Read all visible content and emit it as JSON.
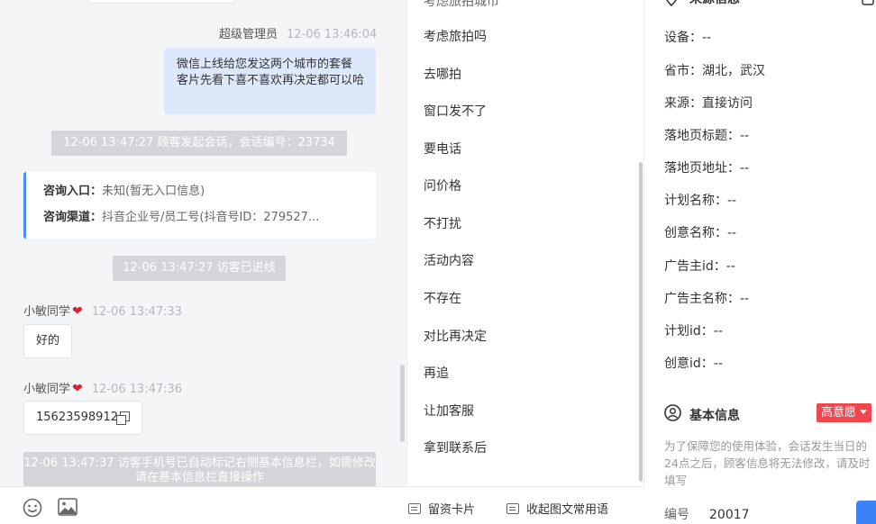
{
  "chat": {
    "agent_msg": {
      "name": "超级管理员",
      "time": "12-06 13:46:04",
      "text": "微信上线给您发这两个城市的套餐 客片先看下喜不喜欢再决定都可以哈"
    },
    "sys_session": "12-06 13:47:27 顾客发起会话，会话编号：23734",
    "consult": {
      "entry_label": "咨询入口：",
      "entry_value": "未知(暂无入口信息)",
      "channel_label": "咨询渠道：",
      "channel_value": "抖音企业号/员工号(抖音号ID：279527..."
    },
    "sys_entered": "12-06 13:47:27 访客已进线",
    "msg1": {
      "name": "小敏同学",
      "time": "12-06 13:47:33",
      "text": "好的"
    },
    "msg2": {
      "name": "小敏同学",
      "time": "12-06 13:47:36",
      "text": "15623598912"
    },
    "sys_phone": "12-06 13:47:37 访客手机号已自动标记右侧基本信息栏，如需修改请在基本信息栏直接操作"
  },
  "toolbar": {
    "emoji_icon": "emoji-icon",
    "image_icon": "image-icon",
    "card_label": "留资卡片",
    "collapse_label": "收起图文常用语"
  },
  "quick_replies": [
    "考虑旅拍吗",
    "去哪拍",
    "窗口发不了",
    "要电话",
    "问价格",
    "不打扰",
    "活动内容",
    "不存在",
    "对比再决定",
    "再追",
    "让加客服",
    "拿到联系后"
  ],
  "source_info": {
    "title": "来源信息",
    "fields": [
      "设备：--",
      "省市：湖北，武汉",
      "来源：直接访问",
      "落地页标题：--",
      "落地页地址：--",
      "计划名称：--",
      "创意名称：--",
      "广告主id：--",
      "广告主名称：--",
      "计划id：--",
      "创意id：--"
    ]
  },
  "basic_info": {
    "title": "基本信息",
    "intent_tag": "高意愿",
    "note": "为了保障您的使用体验，会话发生当日的24点之后，顾客信息将无法修改，请及时填写",
    "id_label": "编号",
    "id_value": "20017"
  },
  "colors": {
    "accent": "#4a8ef5",
    "tag": "#f0464e",
    "bubble_out": "#dde9fb",
    "system": "#d4d5d8"
  }
}
